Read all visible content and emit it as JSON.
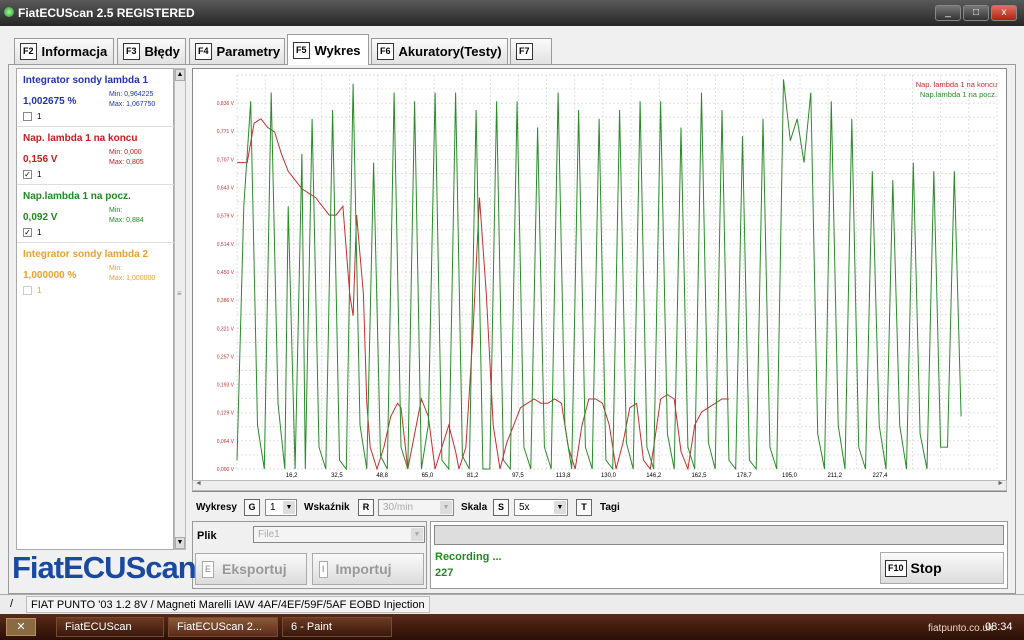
{
  "window": {
    "title": "FiatECUScan 2.5 REGISTERED",
    "minimize": "_",
    "restore": "□",
    "close": "x"
  },
  "tabs": [
    {
      "key": "F2",
      "label": "Informacja"
    },
    {
      "key": "F3",
      "label": "Błędy"
    },
    {
      "key": "F4",
      "label": "Parametry"
    },
    {
      "key": "F5",
      "label": "Wykres"
    },
    {
      "key": "F6",
      "label": "Akuratory(Testy)"
    },
    {
      "key": "F7",
      "label": ""
    }
  ],
  "sensors": [
    {
      "name": "Integrator sondy lambda 1",
      "value": "1,002675 %",
      "min": "Min: 0,964225",
      "max": "Max: 1,067750",
      "checked": "",
      "num": "1",
      "color": "#2233aa"
    },
    {
      "name": "Nap. lambda 1 na koncu",
      "value": "0,156 V",
      "min": "Min: 0,000",
      "max": "Max: 0,805",
      "checked": "✓",
      "num": "1",
      "color": "#c02020"
    },
    {
      "name": "Nap.lambda 1 na pocz.",
      "value": "0,092 V",
      "min": "Min:",
      "max": "Max: 0,884",
      "checked": "✓",
      "num": "1",
      "color": "#228822"
    },
    {
      "name": "Integrator sondy lambda 2",
      "value": "1,000000 %",
      "min": "Min:",
      "max": "Max: 1,000000",
      "checked": "",
      "num": "1",
      "color": "#e8a030"
    }
  ],
  "chart_data": {
    "type": "line",
    "y_ticks": [
      "0,000 V",
      "0,064 V",
      "0,129 V",
      "0,193 V",
      "0,257 V",
      "0,321 V",
      "0,386 V",
      "0,450 V",
      "0,514 V",
      "0,579 V",
      "0,643 V",
      "0,707 V",
      "0,771 V",
      "0,836 V"
    ],
    "x_ticks": [
      "16,2",
      "32,5",
      "48,8",
      "65,0",
      "81,2",
      "97,5",
      "113,8",
      "130,0",
      "146,2",
      "162,5",
      "178,7",
      "195,0",
      "211,2",
      "227,4"
    ],
    "ylim": [
      0,
      0.9
    ],
    "xlim": [
      0,
      445
    ],
    "grid": true,
    "legend_position": "top-right",
    "series": [
      {
        "name": "Nap. lambda 1 na koncu",
        "color": "#c03030",
        "x": [
          0,
          6,
          10,
          14,
          18,
          22,
          26,
          30,
          34,
          38,
          42,
          46,
          48,
          50,
          54,
          58,
          62,
          66,
          68,
          70,
          74,
          76,
          78,
          82,
          86,
          90,
          94,
          96,
          100,
          104,
          108,
          112,
          116,
          120,
          124,
          128,
          130,
          134,
          138,
          142,
          146,
          150,
          154,
          158,
          162,
          166,
          170,
          174,
          178,
          182,
          186,
          190,
          194,
          198,
          202,
          206,
          210,
          214,
          218,
          222,
          226,
          230,
          234,
          238,
          242,
          244,
          248,
          252,
          256,
          260,
          264,
          268,
          272,
          276,
          280,
          284,
          288
        ],
        "y": [
          0.7,
          0.7,
          0.79,
          0.8,
          0.78,
          0.77,
          0.72,
          0.68,
          0.66,
          0.64,
          0.63,
          0.62,
          0.61,
          0.6,
          0.58,
          0.58,
          0.6,
          0.4,
          0.35,
          0.58,
          0.4,
          0.15,
          0.05,
          0.0,
          0.05,
          0.12,
          0.15,
          0.14,
          0.0,
          0.08,
          0.16,
          0.12,
          0.0,
          0.05,
          0.1,
          0.04,
          0.0,
          0.05,
          0.3,
          0.62,
          0.4,
          0.1,
          0.0,
          0.06,
          0.1,
          0.14,
          0.15,
          0.16,
          0.15,
          0.15,
          0.16,
          0.15,
          0.05,
          0.0,
          0.1,
          0.16,
          0.16,
          0.15,
          0.1,
          0.0,
          0.06,
          0.14,
          0.15,
          0.02,
          0.0,
          0.05,
          0.16,
          0.17,
          0.16,
          0.04,
          0.0,
          0.1,
          0.13,
          0.14,
          0.15,
          0.16,
          0.16
        ]
      },
      {
        "name": "Nap.lambda 1 na pocz.",
        "color": "#2a8a2a",
        "x": [
          0,
          4,
          8,
          12,
          16,
          20,
          24,
          28,
          30,
          34,
          38,
          40,
          44,
          48,
          52,
          56,
          60,
          64,
          68,
          72,
          76,
          80,
          84,
          88,
          92,
          96,
          100,
          104,
          108,
          112,
          116,
          120,
          124,
          128,
          132,
          136,
          140,
          144,
          148,
          152,
          156,
          160,
          164,
          168,
          172,
          176,
          180,
          184,
          188,
          192,
          196,
          200,
          204,
          208,
          212,
          216,
          220,
          224,
          228,
          232,
          236,
          240,
          244,
          248,
          252,
          256,
          260,
          264,
          268,
          272,
          276,
          280,
          284,
          288,
          292,
          296,
          300,
          304,
          308,
          312,
          316,
          320,
          324,
          328,
          332,
          336,
          340,
          344,
          348,
          352,
          356,
          360,
          364,
          368,
          372,
          376,
          380,
          384,
          388,
          392,
          396,
          400,
          404,
          408,
          412,
          416,
          420,
          424
        ],
        "y": [
          0.02,
          0.6,
          0.84,
          0.1,
          0.0,
          0.86,
          0.15,
          0.0,
          0.6,
          0.0,
          0.72,
          0.0,
          0.8,
          0.05,
          0.0,
          0.82,
          0.02,
          0.0,
          0.88,
          0.1,
          0.0,
          0.7,
          0.03,
          0.0,
          0.86,
          0.05,
          0.0,
          0.84,
          0.0,
          0.1,
          0.86,
          0.02,
          0.0,
          0.86,
          0.03,
          0.0,
          0.82,
          0.0,
          0.0,
          0.84,
          0.02,
          0.0,
          0.84,
          0.05,
          0.0,
          0.78,
          0.05,
          0.0,
          0.86,
          0.1,
          0.0,
          0.82,
          0.05,
          0.0,
          0.8,
          0.02,
          0.0,
          0.82,
          0.06,
          0.0,
          0.84,
          0.05,
          0.0,
          0.84,
          0.08,
          0.0,
          0.78,
          0.05,
          0.0,
          0.86,
          0.06,
          0.0,
          0.82,
          0.02,
          0.0,
          0.76,
          0.02,
          0.0,
          0.8,
          0.05,
          0.0,
          0.89,
          0.75,
          0.8,
          0.7,
          0.86,
          0.08,
          0.0,
          0.84,
          0.1,
          0.0,
          0.8,
          0.05,
          0.0,
          0.68,
          0.1,
          0.0,
          0.66,
          0.1,
          0.0,
          0.7,
          0.08,
          0.0,
          0.68,
          0.05,
          0.05,
          0.68,
          0.12
        ]
      }
    ]
  },
  "controls": {
    "wykresy": "Wykresy",
    "wykresy_key": "G",
    "wykresy_val": "1",
    "wskaznik": "Wskaźnik",
    "wskaznik_key": "R",
    "wskaznik_val": "30/min",
    "skala": "Skala",
    "skala_key": "S",
    "skala_val": "5x",
    "tagi_key": "T",
    "tagi": "Tagi"
  },
  "plik": {
    "label": "Plik",
    "value": "File1",
    "export_key": "E",
    "export": "Eksportuj",
    "import_key": "I",
    "import": "Importuj"
  },
  "recording": {
    "status": "Recording ...",
    "count": "227",
    "stop_key": "F10",
    "stop": "Stop"
  },
  "logo": "FiatECUScan",
  "statusbar": {
    "slash": "/",
    "vehicle": "FIAT PUNTO '03 1.2 8V / Magneti Marelli IAW 4AF/4EF/59F/5AF EOBD Injection"
  },
  "taskbar": {
    "items": [
      "FiatECUScan",
      "FiatECUScan 2...",
      "6 - Paint"
    ],
    "clock": "08:34",
    "watermark": "fiatpunto.co.uk"
  }
}
